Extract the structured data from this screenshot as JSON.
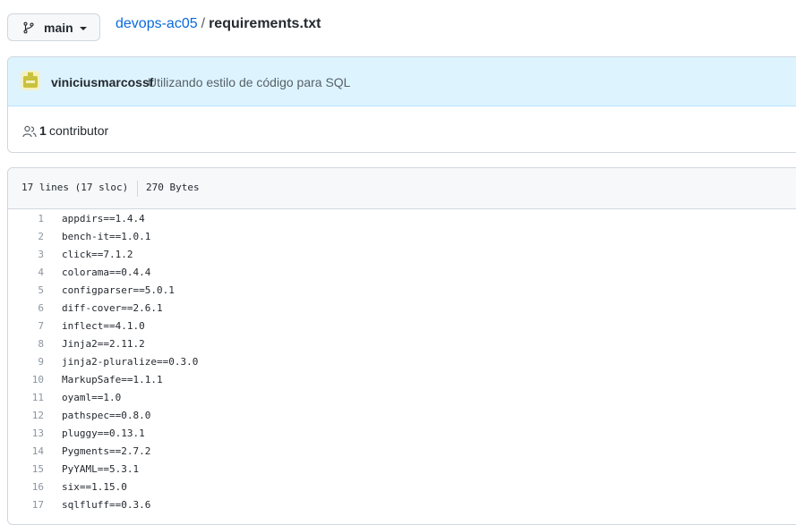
{
  "branch": {
    "label": "main",
    "icon": "git-branch-icon"
  },
  "breadcrumb": {
    "repo": "devops-ac05",
    "separator": "/",
    "file": "requirements.txt"
  },
  "commit": {
    "author": "viniciusmarcossf",
    "message": "Utilizando estilo de código para SQL",
    "avatar_color": "#c9c23e"
  },
  "contributors": {
    "count": "1",
    "label": "contributor"
  },
  "file_info": {
    "lines": "17 lines (17 sloc)",
    "size": "270 Bytes"
  },
  "code_lines": [
    {
      "n": "1",
      "text": "appdirs==1.4.4"
    },
    {
      "n": "2",
      "text": "bench-it==1.0.1"
    },
    {
      "n": "3",
      "text": "click==7.1.2"
    },
    {
      "n": "4",
      "text": "colorama==0.4.4"
    },
    {
      "n": "5",
      "text": "configparser==5.0.1"
    },
    {
      "n": "6",
      "text": "diff-cover==2.6.1"
    },
    {
      "n": "7",
      "text": "inflect==4.1.0"
    },
    {
      "n": "8",
      "text": "Jinja2==2.11.2"
    },
    {
      "n": "9",
      "text": "jinja2-pluralize==0.3.0"
    },
    {
      "n": "10",
      "text": "MarkupSafe==1.1.1"
    },
    {
      "n": "11",
      "text": "oyaml==1.0"
    },
    {
      "n": "12",
      "text": "pathspec==0.8.0"
    },
    {
      "n": "13",
      "text": "pluggy==0.13.1"
    },
    {
      "n": "14",
      "text": "Pygments==2.7.2"
    },
    {
      "n": "15",
      "text": "PyYAML==5.3.1"
    },
    {
      "n": "16",
      "text": "six==1.15.0"
    },
    {
      "n": "17",
      "text": "sqlfluff==0.3.6"
    }
  ]
}
